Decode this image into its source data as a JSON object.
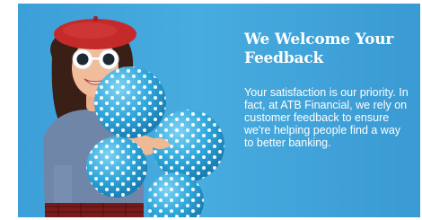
{
  "banner": {
    "headline": "We Welcome Your Feedback",
    "body": "Your satisfaction is our priority. In fact, at ATB Financial, we rely on customer feedback to ensure we're helping people find a way to better banking.",
    "image": {
      "subject": "smiling woman in red beret and white sunglasses holding polka-dot balloons",
      "background_color": "#45a9dd",
      "balloon_color": "#39afe0"
    }
  }
}
